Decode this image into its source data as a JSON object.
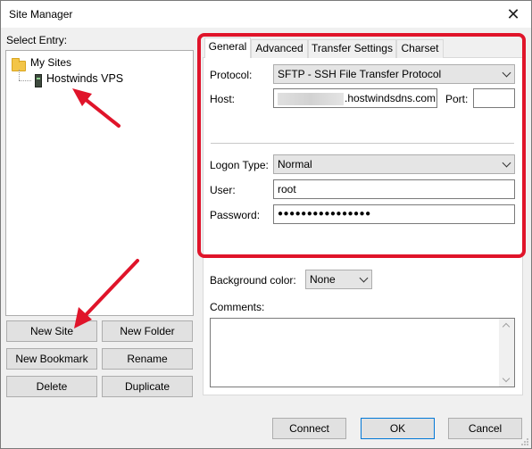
{
  "window": {
    "title": "Site Manager",
    "close_glyph": "✕"
  },
  "left": {
    "select_entry_label": "Select Entry:",
    "tree": {
      "root": "My Sites",
      "child": "Hostwinds VPS"
    },
    "buttons": {
      "new_site": "New Site",
      "new_folder": "New Folder",
      "new_bookmark": "New Bookmark",
      "rename": "Rename",
      "delete": "Delete",
      "duplicate": "Duplicate"
    }
  },
  "tabs": [
    "General",
    "Advanced",
    "Transfer Settings",
    "Charset"
  ],
  "general": {
    "protocol_label": "Protocol:",
    "protocol_value": "SFTP - SSH File Transfer Protocol",
    "host_label": "Host:",
    "host_value": ".hostwindsdns.com",
    "port_label": "Port:",
    "port_value": "",
    "logon_type_label": "Logon Type:",
    "logon_type_value": "Normal",
    "user_label": "User:",
    "user_value": "root",
    "password_label": "Password:",
    "password_value": "●●●●●●●●●●●●●●●●",
    "background_color_label": "Background color:",
    "background_color_value": "None",
    "comments_label": "Comments:"
  },
  "footer": {
    "connect": "Connect",
    "ok": "OK",
    "cancel": "Cancel"
  },
  "colors": {
    "annotation": "#e0142a",
    "accent": "#0078d7"
  }
}
